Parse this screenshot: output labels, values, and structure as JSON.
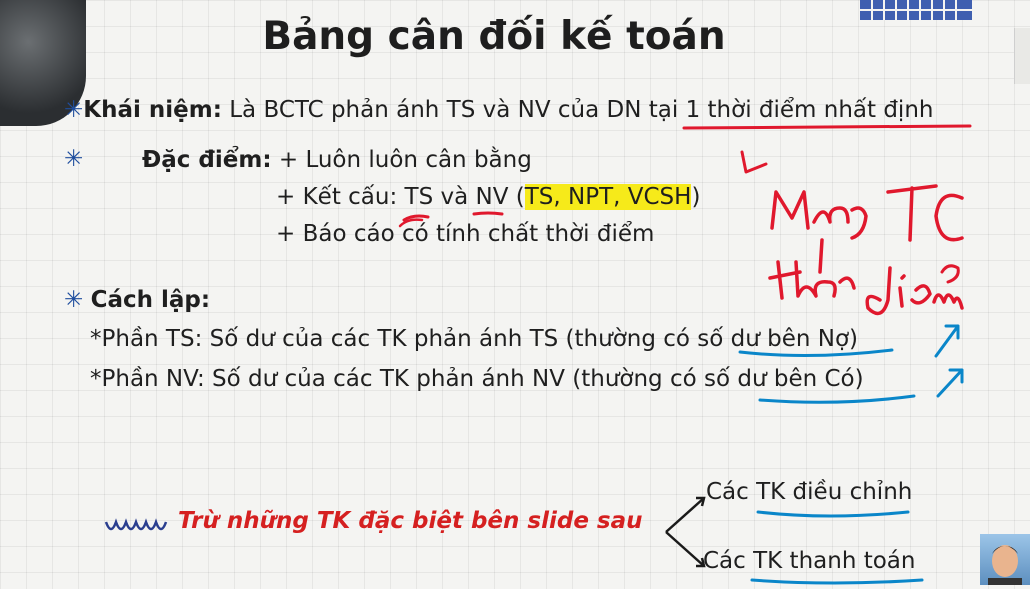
{
  "slide": {
    "title": "Bảng cân đối kế toán",
    "bullet_symbol": "✳",
    "concept": {
      "label": "Khái niệm:",
      "text_before": " Là BCTC phản ánh TS và NV của DN ",
      "text_underlined": "tại 1 thời điểm nhất định"
    },
    "features": {
      "label": "Đặc điểm:",
      "line1": " + Luôn luôn cân bằng",
      "line2_prefix": "+ Kết cấu: TS và NV (",
      "line2_highlight": "TS, NPT, VCSH",
      "line2_suffix": ")",
      "line3": "+ Báo cáo có tính chất thời điểm"
    },
    "method": {
      "label": "Cách lập:",
      "line1": "*Phần TS: Số dư của các TK phản ánh TS (thường có số dư bên Nợ)",
      "line2": "*Phần NV: Số dư của các TK phản ánh NV (thường có số dư bên Có)"
    },
    "exception": {
      "text": "Trừ những TK đặc biệt bên slide sau",
      "branch1": "Các TK điều chỉnh",
      "branch2": "Các TK thanh toán"
    }
  },
  "colors": {
    "accent_blue": "#1f4e9e",
    "highlight": "#f6ea1a",
    "ink_red": "#e0182d",
    "ink_blue": "#0a86c9",
    "red_text": "#d52020"
  },
  "webcam_icons": [
    "presenter-video-icon",
    "presenter-avatar-icon"
  ]
}
